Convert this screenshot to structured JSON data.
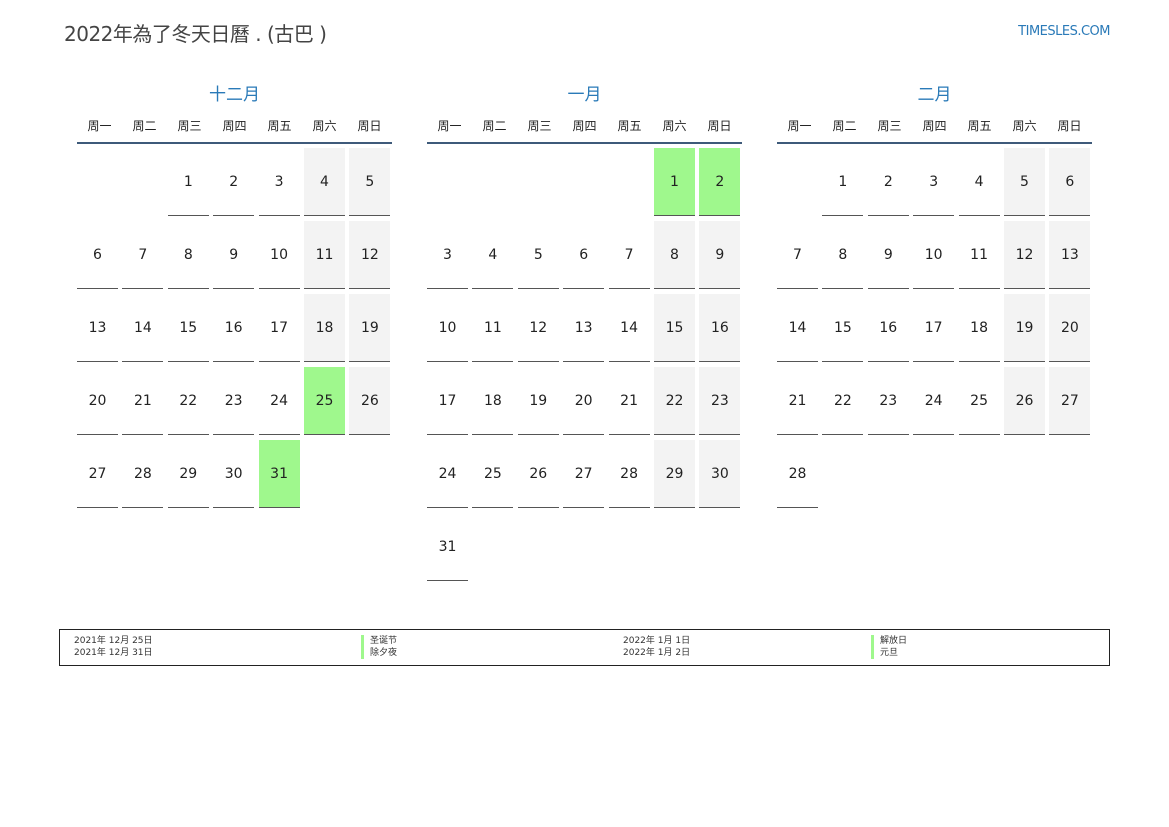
{
  "header": {
    "title": "2022年為了冬天日曆 . (古巴 )",
    "site": "TIMESLES.COM"
  },
  "weekday_labels": [
    "周一",
    "周二",
    "周三",
    "周四",
    "周五",
    "周六",
    "周日"
  ],
  "months": [
    {
      "name": "十二月",
      "offset": 2,
      "days": 31,
      "holidays": [
        25,
        31
      ]
    },
    {
      "name": "一月",
      "offset": 5,
      "days": 31,
      "holidays": [
        1,
        2
      ]
    },
    {
      "name": "二月",
      "offset": 1,
      "days": 28,
      "holidays": []
    }
  ],
  "holiday_colors": {
    "holiday": "#9ff88d",
    "weekend": "#f3f3f3",
    "accent": "#2a7ab8"
  },
  "legend": {
    "col1_dates": [
      "2021年 12月 25日",
      "2021年 12月 31日"
    ],
    "col1_names": [
      "圣诞节",
      "除夕夜"
    ],
    "col2_dates": [
      "2022年 1月 1日",
      "2022年 1月 2日"
    ],
    "col2_names": [
      "解放日",
      "元旦"
    ]
  }
}
